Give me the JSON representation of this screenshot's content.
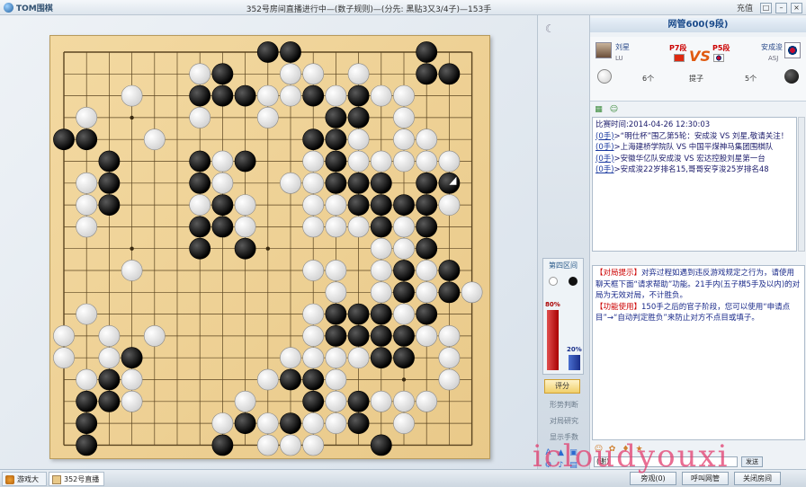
{
  "window": {
    "app_name": "TOM围棋",
    "title": "352号房间直播进行中—(数子规则)—(分先: 黑贴3又3/4子)—153手",
    "charge_label": "充值",
    "controls": [
      "□",
      "–",
      "×"
    ]
  },
  "board": {
    "size": 19,
    "black_stones": [
      [
        9,
        0
      ],
      [
        10,
        0
      ],
      [
        16,
        0
      ],
      [
        7,
        1
      ],
      [
        16,
        1
      ],
      [
        17,
        1
      ],
      [
        6,
        2
      ],
      [
        7,
        2
      ],
      [
        8,
        2
      ],
      [
        11,
        2
      ],
      [
        13,
        2
      ],
      [
        12,
        3
      ],
      [
        13,
        3
      ],
      [
        0,
        4
      ],
      [
        1,
        4
      ],
      [
        11,
        4
      ],
      [
        12,
        4
      ],
      [
        2,
        5
      ],
      [
        6,
        5
      ],
      [
        8,
        5
      ],
      [
        12,
        5
      ],
      [
        2,
        6
      ],
      [
        6,
        6
      ],
      [
        12,
        6
      ],
      [
        13,
        6
      ],
      [
        14,
        6
      ],
      [
        16,
        6
      ],
      [
        17,
        6
      ],
      [
        2,
        7
      ],
      [
        7,
        7
      ],
      [
        13,
        7
      ],
      [
        14,
        7
      ],
      [
        15,
        7
      ],
      [
        16,
        7
      ],
      [
        6,
        8
      ],
      [
        7,
        8
      ],
      [
        14,
        8
      ],
      [
        16,
        8
      ],
      [
        6,
        9
      ],
      [
        8,
        9
      ],
      [
        16,
        9
      ],
      [
        15,
        10
      ],
      [
        17,
        10
      ],
      [
        15,
        11
      ],
      [
        17,
        11
      ],
      [
        12,
        12
      ],
      [
        13,
        12
      ],
      [
        14,
        12
      ],
      [
        16,
        12
      ],
      [
        12,
        13
      ],
      [
        13,
        13
      ],
      [
        14,
        13
      ],
      [
        15,
        13
      ],
      [
        3,
        14
      ],
      [
        14,
        14
      ],
      [
        15,
        14
      ],
      [
        2,
        15
      ],
      [
        10,
        15
      ],
      [
        11,
        15
      ],
      [
        1,
        16
      ],
      [
        2,
        16
      ],
      [
        11,
        16
      ],
      [
        13,
        16
      ],
      [
        1,
        17
      ],
      [
        8,
        17
      ],
      [
        10,
        17
      ],
      [
        13,
        17
      ],
      [
        1,
        18
      ],
      [
        7,
        18
      ],
      [
        14,
        18
      ],
      [
        2,
        19
      ],
      [
        9,
        19
      ],
      [
        10,
        19
      ],
      [
        11,
        19
      ],
      [
        12,
        19
      ],
      [
        14,
        19
      ],
      [
        16,
        19
      ],
      [
        17,
        19
      ],
      [
        16,
        20
      ],
      [
        17,
        20
      ],
      [
        5,
        21
      ],
      [
        7,
        21
      ],
      [
        16,
        21
      ]
    ],
    "white_stones": [
      [
        12,
        -1
      ],
      [
        6,
        1
      ],
      [
        10,
        1
      ],
      [
        11,
        1
      ],
      [
        13,
        1
      ],
      [
        3,
        2
      ],
      [
        9,
        2
      ],
      [
        10,
        2
      ],
      [
        12,
        2
      ],
      [
        14,
        2
      ],
      [
        15,
        2
      ],
      [
        1,
        3
      ],
      [
        6,
        3
      ],
      [
        9,
        3
      ],
      [
        15,
        3
      ],
      [
        1,
        4
      ],
      [
        4,
        4
      ],
      [
        13,
        4
      ],
      [
        15,
        4
      ],
      [
        16,
        4
      ],
      [
        12,
        5
      ],
      [
        15,
        5
      ],
      [
        16,
        5
      ],
      [
        7,
        5
      ],
      [
        8,
        5
      ],
      [
        11,
        5
      ],
      [
        13,
        5
      ],
      [
        14,
        5
      ],
      [
        17,
        5
      ],
      [
        1,
        6
      ],
      [
        7,
        6
      ],
      [
        10,
        6
      ],
      [
        11,
        6
      ],
      [
        1,
        7
      ],
      [
        6,
        7
      ],
      [
        8,
        7
      ],
      [
        11,
        7
      ],
      [
        12,
        7
      ],
      [
        17,
        7
      ],
      [
        1,
        8
      ],
      [
        8,
        8
      ],
      [
        11,
        8
      ],
      [
        12,
        8
      ],
      [
        13,
        8
      ],
      [
        15,
        8
      ],
      [
        14,
        9
      ],
      [
        15,
        9
      ],
      [
        16,
        9
      ],
      [
        3,
        10
      ],
      [
        11,
        10
      ],
      [
        12,
        10
      ],
      [
        14,
        10
      ],
      [
        16,
        10
      ],
      [
        12,
        11
      ],
      [
        14,
        11
      ],
      [
        16,
        11
      ],
      [
        18,
        11
      ],
      [
        1,
        12
      ],
      [
        11,
        12
      ],
      [
        15,
        12
      ],
      [
        0,
        13
      ],
      [
        2,
        13
      ],
      [
        4,
        13
      ],
      [
        11,
        13
      ],
      [
        16,
        13
      ],
      [
        17,
        13
      ],
      [
        0,
        14
      ],
      [
        2,
        14
      ],
      [
        10,
        14
      ],
      [
        11,
        14
      ],
      [
        12,
        14
      ],
      [
        13,
        14
      ],
      [
        17,
        14
      ],
      [
        1,
        15
      ],
      [
        3,
        15
      ],
      [
        9,
        15
      ],
      [
        12,
        15
      ],
      [
        17,
        15
      ],
      [
        1,
        16
      ],
      [
        3,
        16
      ],
      [
        8,
        16
      ],
      [
        12,
        16
      ],
      [
        14,
        16
      ],
      [
        15,
        16
      ],
      [
        16,
        16
      ],
      [
        7,
        17
      ],
      [
        9,
        17
      ],
      [
        11,
        17
      ],
      [
        12,
        17
      ],
      [
        15,
        17
      ],
      [
        7,
        18
      ],
      [
        9,
        18
      ],
      [
        10,
        18
      ],
      [
        11,
        18
      ],
      [
        5,
        19
      ],
      [
        6,
        19
      ],
      [
        12,
        19
      ],
      [
        6,
        20
      ],
      [
        13,
        20
      ],
      [
        14,
        20
      ],
      [
        15,
        20
      ]
    ],
    "last_move": [
      17,
      6
    ]
  },
  "sidetool": {
    "region_title": "第四区间",
    "black_pct_label": "80%",
    "white_pct_label": "20%",
    "black_pct": 80,
    "white_pct": 20,
    "score_button": "评分",
    "links": [
      "形势判断",
      "对局研究",
      "显示手数"
    ]
  },
  "panel": {
    "room_title": "网管600(9段)",
    "white_player": {
      "name": "刘星",
      "rank": "P7段",
      "id": "LU",
      "captures": "6个"
    },
    "black_player": {
      "name": "安成浚",
      "rank": "P5段",
      "id": "ASJ",
      "captures": "5个"
    },
    "vs": "VS",
    "captures_label": "提子",
    "log": [
      {
        "src": "",
        "text": "比赛时间:2014-04-26 12:30:03"
      },
      {
        "src": "(0手)",
        "text": ">“明仕杯”围乙第5轮：安成浚 VS 刘星,敬请关注！"
      },
      {
        "src": "(0手)",
        "text": ">上海建桥学院队 VS 中国平煤神马集团围棋队"
      },
      {
        "src": "(0手)",
        "text": ">安徽华亿队安成浚 VS 宏达控股刘星第一台"
      },
      {
        "src": "(0手)",
        "text": ">安成浚22岁排名15,哥哥安亨浚25岁排名48"
      }
    ],
    "tips": [
      {
        "head": "【对局提示】",
        "text": "对弈过程如遇到违反游戏规定之行为，请使用聊天框下面“请求帮助”功能。21手内(五子棋5手及以内)的对局为无效对局，不计胜负。"
      },
      {
        "head": "【功能使用】",
        "text": "150手之后的官子阶段，您可以使用“申请点目”→“自动判定胜负”来防止对方不点目或填子。"
      }
    ],
    "chat_placeholder": "(谢)",
    "send_label": "发送"
  },
  "bottom": {
    "tabs": [
      "游戏大厅",
      "352号直播室"
    ],
    "buttons": [
      "旁观(0)",
      "呼叫网管",
      "关闭房间"
    ]
  },
  "watermark": "icloudyouxi",
  "colors": {
    "board": "#e9c989",
    "accent": "#1a4a8a",
    "red_bar": "#c00000",
    "blue_bar": "#1a2f8a"
  }
}
